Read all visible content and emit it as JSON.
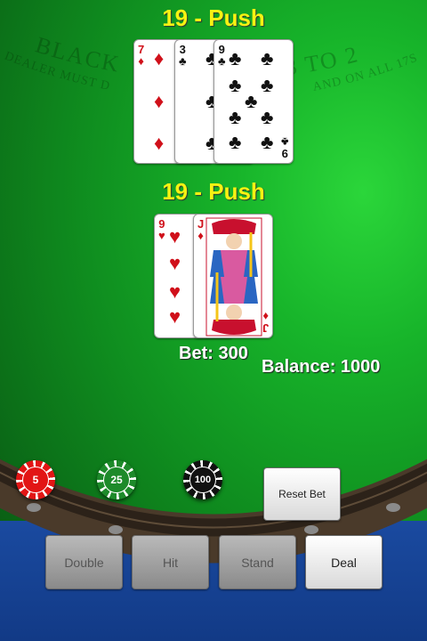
{
  "dealer": {
    "status": "19 - Push",
    "cards": [
      {
        "rank": "7",
        "suit": "♦",
        "color": "red"
      },
      {
        "rank": "3",
        "suit": "♣",
        "color": "black"
      },
      {
        "rank": "9",
        "suit": "♣",
        "color": "black"
      }
    ]
  },
  "player": {
    "status": "19 - Push",
    "cards": [
      {
        "rank": "9",
        "suit": "♥",
        "color": "red"
      },
      {
        "rank": "J",
        "suit": "♦",
        "color": "red"
      }
    ],
    "bet_text": "Bet: 300",
    "balance_text": "Balance: 1000"
  },
  "table_text": {
    "line1_left": "BLACK",
    "line1_right": "3 TO 2",
    "line2_left": "DEALER MUST D",
    "line2_right": "AND ON ALL 17S"
  },
  "chips": [
    {
      "label": "5"
    },
    {
      "label": "25"
    },
    {
      "label": "100"
    }
  ],
  "buttons": {
    "reset_bet": "Reset Bet",
    "double": "Double",
    "hit": "Hit",
    "stand": "Stand",
    "deal": "Deal"
  },
  "colors": {
    "status_yellow": "#f7f212",
    "felt_green": "#17b42a",
    "table_blue": "#1a4aa0"
  }
}
